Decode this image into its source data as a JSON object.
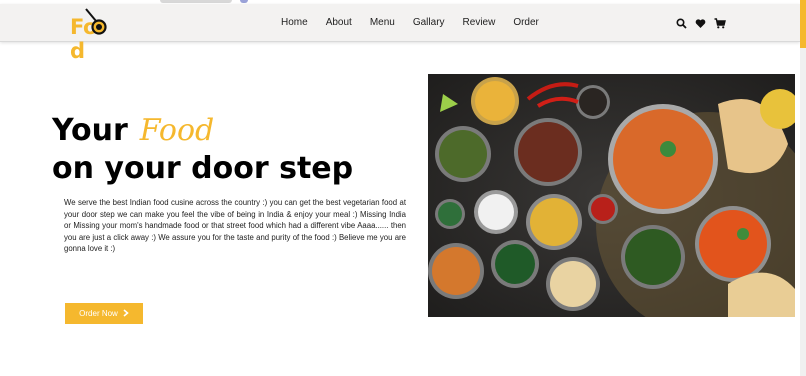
{
  "brand": {
    "logo_text_left": "Fo",
    "logo_text_right": "d"
  },
  "nav": {
    "items": [
      "Home",
      "About",
      "Menu",
      "Gallary",
      "Review",
      "Order"
    ]
  },
  "header_icons": [
    "search-icon",
    "heart-icon",
    "cart-icon"
  ],
  "hero": {
    "title_line1": "Your",
    "title_accent": "Food",
    "title_line2": "on your door step",
    "description": "We serve the best Indian food cusine across the country :) you can get the best vegetarian food at your door step we can make you feel the vibe of being in India & enjoy your meal :) Missing India or Missing your mom's handmade food or that street food which had a different vibe Aaaa...... then you are just a click away :) We assure you for the taste and purity of the food :) Believe me you are gonna love it :)",
    "cta_label": "Order Now",
    "cta_icon": "chevron-right-icon"
  },
  "colors": {
    "accent": "#f5b82e",
    "header_bg": "#f3f2f1",
    "text": "#111111"
  }
}
